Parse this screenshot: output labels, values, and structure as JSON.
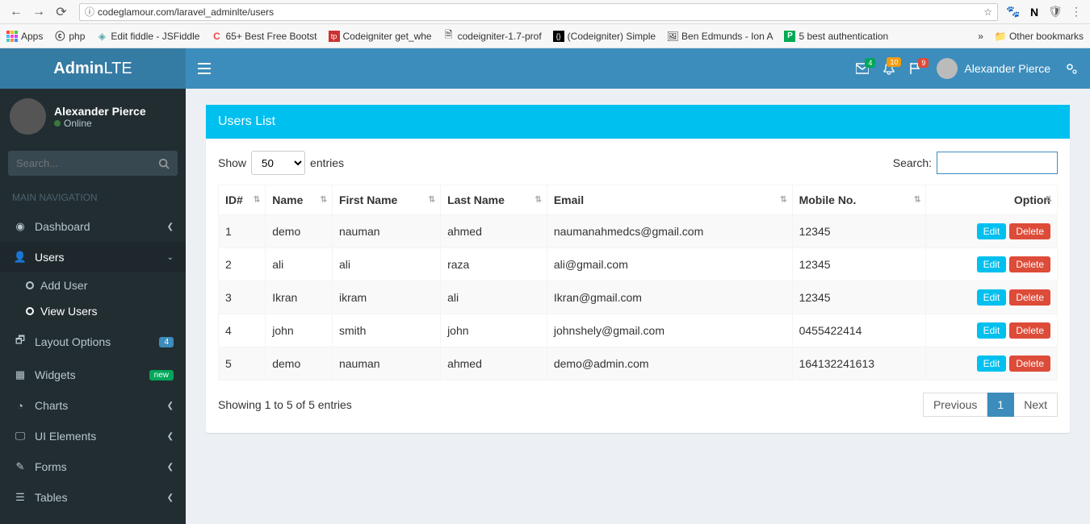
{
  "browser": {
    "url": "codeglamour.com/laravel_adminlte/users",
    "bookmarks": [
      {
        "label": "Apps",
        "icon": "apps"
      },
      {
        "label": "php",
        "icon": "php"
      },
      {
        "label": "Edit fiddle - JSFiddle",
        "icon": "jsfiddle"
      },
      {
        "label": "65+ Best Free Bootst",
        "icon": "c-red"
      },
      {
        "label": "Codeigniter get_whe",
        "icon": "tp"
      },
      {
        "label": "codeigniter-1.7-prof",
        "icon": "doc"
      },
      {
        "label": "(Codeigniter) Simple",
        "icon": "ci"
      },
      {
        "label": "Ben Edmunds - Ion A",
        "icon": "ben"
      },
      {
        "label": "5 best authentication",
        "icon": "p-green"
      }
    ],
    "other_bookmarks": "Other bookmarks"
  },
  "logo": {
    "bold": "Admin",
    "light": "LTE"
  },
  "topbar": {
    "badges": {
      "mail": "4",
      "bell": "10",
      "flag": "9"
    },
    "user": "Alexander Pierce"
  },
  "sidebar": {
    "user": {
      "name": "Alexander Pierce",
      "status": "Online"
    },
    "search_placeholder": "Search...",
    "header": "MAIN NAVIGATION",
    "items": {
      "dashboard": "Dashboard",
      "users": "Users",
      "add_user": "Add User",
      "view_users": "View Users",
      "layout_options": "Layout Options",
      "layout_badge": "4",
      "widgets": "Widgets",
      "widgets_badge": "new",
      "charts": "Charts",
      "ui_elements": "UI Elements",
      "forms": "Forms",
      "tables": "Tables"
    }
  },
  "box": {
    "title": "Users List"
  },
  "datatable": {
    "show_label": "Show",
    "entries_label": "entries",
    "page_size": "50",
    "search_label": "Search:",
    "columns": [
      "ID#",
      "Name",
      "First Name",
      "Last Name",
      "Email",
      "Mobile No.",
      "Option"
    ],
    "rows": [
      {
        "id": "1",
        "name": "demo",
        "first": "nauman",
        "last": "ahmed",
        "email": "naumanahmedcs@gmail.com",
        "mobile": "12345"
      },
      {
        "id": "2",
        "name": "ali",
        "first": "ali",
        "last": "raza",
        "email": "ali@gmail.com",
        "mobile": "12345"
      },
      {
        "id": "3",
        "name": "Ikran",
        "first": "ikram",
        "last": "ali",
        "email": "Ikran@gmail.com",
        "mobile": "12345"
      },
      {
        "id": "4",
        "name": "john",
        "first": "smith",
        "last": "john",
        "email": "johnshely@gmail.com",
        "mobile": "0455422414"
      },
      {
        "id": "5",
        "name": "demo",
        "first": "nauman",
        "last": "ahmed",
        "email": "demo@admin.com",
        "mobile": "164132241613"
      }
    ],
    "edit_label": "Edit",
    "delete_label": "Delete",
    "info": "Showing 1 to 5 of 5 entries",
    "prev": "Previous",
    "page": "1",
    "next": "Next"
  }
}
